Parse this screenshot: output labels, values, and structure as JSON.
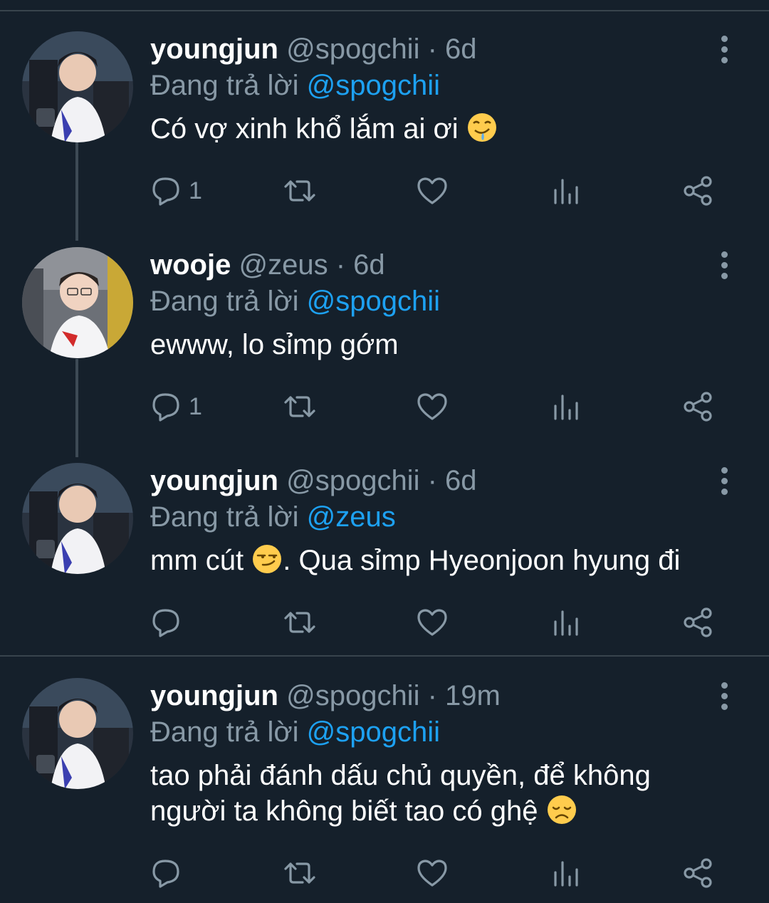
{
  "tweets": [
    {
      "name": "youngjun",
      "handle": "@spogchii",
      "dot": " · ",
      "time": "6d",
      "reply_prefix": "Đang trả lời ",
      "reply_to": "@spogchii",
      "text_before": "Có vợ xinh khổ lắm ai ơi ",
      "emoji": "drooling-face-icon",
      "text_after": "",
      "reply_count": "1"
    },
    {
      "name": "wooje",
      "handle": "@zeus",
      "dot": " · ",
      "time": "6d",
      "reply_prefix": "Đang trả lời ",
      "reply_to": "@spogchii",
      "text_before": "ewww, lo sỉmp gớm",
      "emoji": "",
      "text_after": "",
      "reply_count": "1"
    },
    {
      "name": "youngjun",
      "handle": "@spogchii",
      "dot": " · ",
      "time": "6d",
      "reply_prefix": "Đang trả lời ",
      "reply_to": "@zeus",
      "text_before": "mm cút ",
      "emoji": "smirking-face-icon",
      "text_after": ". Qua sỉmp Hyeonjoon hyung đi",
      "reply_count": ""
    },
    {
      "name": "youngjun",
      "handle": "@spogchii",
      "dot": " · ",
      "time": "19m",
      "reply_prefix": "Đang trả lời ",
      "reply_to": "@spogchii",
      "text_before": "tao phải đánh dấu chủ quyền, để không người ta không biết tao có ghệ ",
      "emoji": "disappointed-face-icon",
      "text_after": "",
      "reply_count": ""
    }
  ],
  "colors": {
    "background": "#15202b",
    "divider": "#38444d",
    "secondary_text": "#8899a6",
    "accent": "#1da1f2"
  }
}
